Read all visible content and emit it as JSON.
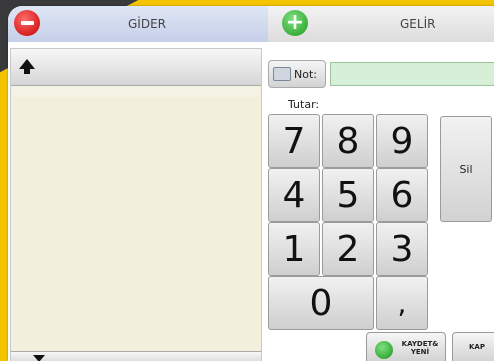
{
  "tabs": {
    "gider": {
      "label": "GİDER",
      "icon": "minus-circle-icon",
      "color": "#d00000"
    },
    "gelir": {
      "label": "GELİR",
      "icon": "plus-circle-icon",
      "color": "#1e9a1e"
    }
  },
  "left_panel": {
    "scroll_up_icon": "arrow-up-icon",
    "scroll_down_icon": "arrow-down-icon"
  },
  "note": {
    "button_label": "Not:",
    "value": ""
  },
  "amount": {
    "label": "Tutar:",
    "value": ""
  },
  "keypad": {
    "keys": [
      "7",
      "8",
      "9",
      "4",
      "5",
      "6",
      "1",
      "2",
      "3"
    ],
    "zero": "0",
    "comma": ","
  },
  "delete_label": "Sil",
  "actions": {
    "save_label": "KAYDET& YENİ",
    "cancel_label": "KAP"
  },
  "colors": {
    "background": "#3a3a3c",
    "accent": "#f5c400",
    "note_field": "#d7efd7"
  }
}
